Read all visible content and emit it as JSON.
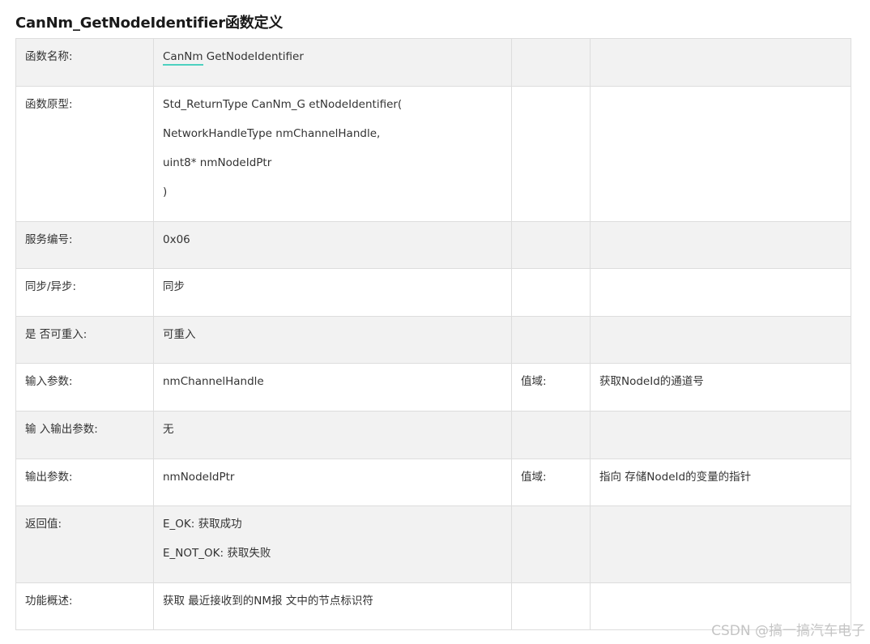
{
  "title": "CanNm_GetNodeIdentifier函数定义",
  "rows": [
    {
      "label": "函数名称:",
      "value_link": "CanNm",
      "value_rest": " GetNodeIdentifier",
      "col3": "",
      "col4": ""
    },
    {
      "label": "函数原型:",
      "value_lines": [
        "Std_ReturnType CanNm_G etNodeIdentifier(",
        "NetworkHandleType nmChannelHandle,",
        "uint8* nmNodeIdPtr",
        ")"
      ],
      "col3": "",
      "col4": ""
    },
    {
      "label": "服务编号:",
      "value": "0x06",
      "col3": "",
      "col4": ""
    },
    {
      "label": "同步/异步:",
      "value": "同步",
      "col3": "",
      "col4": ""
    },
    {
      "label": "是 否可重入:",
      "value": "可重入",
      "col3": "",
      "col4": ""
    },
    {
      "label": "输入参数:",
      "value": "nmChannelHandle",
      "col3": "值域:",
      "col4": "获取NodeId的通道号"
    },
    {
      "label": "输 入输出参数:",
      "value": "无",
      "col3": "",
      "col4": ""
    },
    {
      "label": "输出参数:",
      "value": "nmNodeIdPtr",
      "col3": "值域:",
      "col4": "指向 存储NodeId的变量的指针"
    },
    {
      "label": "返回值:",
      "value_lines": [
        "E_OK: 获取成功",
        "E_NOT_OK: 获取失败"
      ],
      "col3": "",
      "col4": ""
    },
    {
      "label": "功能概述:",
      "value": "获取 最近接收到的NM报 文中的节点标识符",
      "col3": "",
      "col4": ""
    }
  ],
  "watermark": "CSDN @搞一搞汽车电子",
  "colors": {
    "row_shaded": "#f2f2f2",
    "row_plain": "#ffffff",
    "border": "#dddddd",
    "link_underline": "#4ed1c0"
  }
}
